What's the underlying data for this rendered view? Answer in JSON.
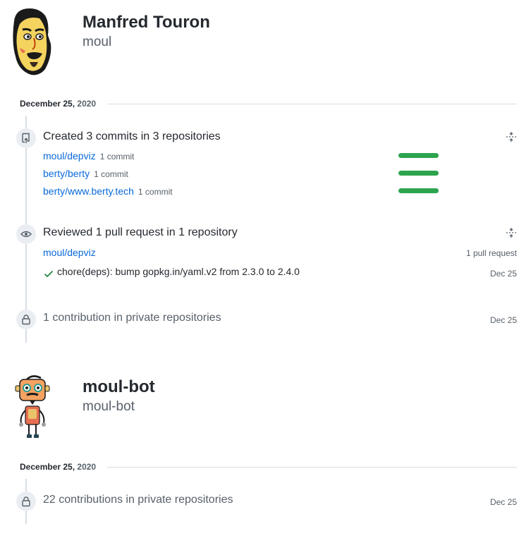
{
  "users": [
    {
      "name": "Manfred Touron",
      "login": "moul",
      "date": {
        "day": "December 25,",
        "year": "2020"
      },
      "commits": {
        "title": "Created 3 commits in 3 repositories",
        "repos": [
          {
            "name": "moul/depviz",
            "count": "1 commit",
            "level": 1
          },
          {
            "name": "berty/berty",
            "count": "1 commit",
            "level": 1
          },
          {
            "name": "berty/www.berty.tech",
            "count": "1 commit",
            "level": 1
          }
        ]
      },
      "reviews": {
        "title": "Reviewed 1 pull request in 1 repository",
        "repo": "moul/depviz",
        "repo_count": "1 pull request",
        "pr_title": "chore(deps): bump gopkg.in/yaml.v2 from 2.3.0 to 2.4.0",
        "pr_date": "Dec 25"
      },
      "private": {
        "title": "1 contribution in private repositories",
        "date": "Dec 25"
      }
    },
    {
      "name": "moul-bot",
      "login": "moul-bot",
      "date": {
        "day": "December 25,",
        "year": "2020"
      },
      "private": {
        "title": "22 contributions in private repositories",
        "date": "Dec 25"
      }
    }
  ],
  "colors": {
    "accent": "#0969da",
    "bar": "#2da44e",
    "muted": "#57606a",
    "line": "#d8dee4"
  },
  "icons": {
    "commit_badge": "repo-push-icon",
    "review_badge": "eye-icon",
    "private_badge": "lock-icon",
    "fold": "fold-icon",
    "check": "check-icon"
  }
}
